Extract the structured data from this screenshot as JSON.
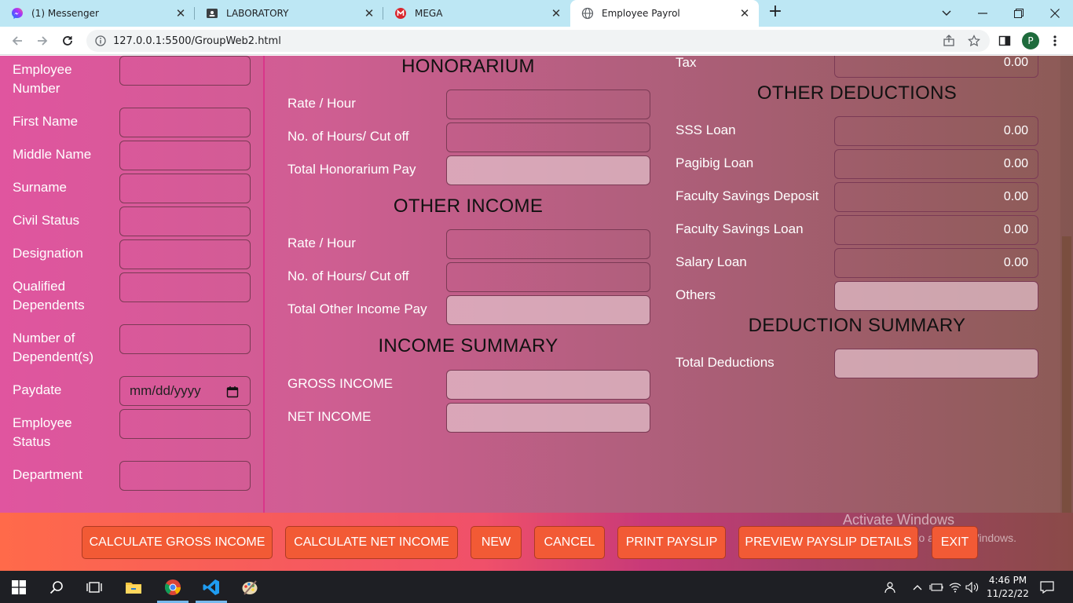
{
  "browser": {
    "tabs": [
      {
        "label": "(1) Messenger",
        "icon": "messenger-icon",
        "active": false
      },
      {
        "label": "LABORATORY",
        "icon": "classroom-icon",
        "active": false
      },
      {
        "label": "MEGA",
        "icon": "mega-icon",
        "active": false
      },
      {
        "label": "Employee Payrol",
        "icon": "globe-icon",
        "active": true
      }
    ],
    "url": "127.0.0.1:5500/GroupWeb2.html",
    "profile_initial": "P"
  },
  "employee": {
    "fields": [
      {
        "label": "Employee Number",
        "value": ""
      },
      {
        "label": "First Name",
        "value": ""
      },
      {
        "label": "Middle Name",
        "value": ""
      },
      {
        "label": "Surname",
        "value": ""
      },
      {
        "label": "Civil Status",
        "value": ""
      },
      {
        "label": "Designation",
        "value": ""
      },
      {
        "label": "Qualified Dependents",
        "value": ""
      },
      {
        "label": "Number of Dependent(s)",
        "value": ""
      },
      {
        "label": "Paydate",
        "value": "",
        "placeholder": "mm/dd/yyyy"
      },
      {
        "label": "Employee Status",
        "value": ""
      },
      {
        "label": "Department",
        "value": ""
      }
    ]
  },
  "honorarium": {
    "title": "HONORARIUM",
    "rate_label": "Rate / Hour",
    "hours_label": "No. of Hours/ Cut off",
    "total_label": "Total Honorarium Pay"
  },
  "other_income": {
    "title": "OTHER INCOME",
    "rate_label": "Rate / Hour",
    "hours_label": "No. of Hours/ Cut off",
    "total_label": "Total Other Income Pay"
  },
  "income_summary": {
    "title": "INCOME SUMMARY",
    "gross_label": "GROSS INCOME",
    "net_label": "NET INCOME"
  },
  "deductions": {
    "tax_label": "Tax",
    "tax_value": "0.00",
    "other_title": "OTHER DEDUCTIONS",
    "items": [
      {
        "label": "SSS Loan",
        "value": "0.00"
      },
      {
        "label": "Pagibig Loan",
        "value": "0.00"
      },
      {
        "label": "Faculty Savings Deposit",
        "value": "0.00"
      },
      {
        "label": "Faculty Savings Loan",
        "value": "0.00"
      },
      {
        "label": "Salary Loan",
        "value": "0.00"
      }
    ],
    "others_label": "Others",
    "summary_title": "DEDUCTION SUMMARY",
    "total_label": "Total Deductions"
  },
  "actions": {
    "calc_gross": "CALCULATE GROSS INCOME",
    "calc_net": "CALCULATE NET INCOME",
    "new": "NEW",
    "cancel": "CANCEL",
    "print": "PRINT PAYSLIP",
    "preview": "PREVIEW PAYSLIP DETAILS",
    "exit": "EXIT"
  },
  "watermark": {
    "title": "Activate Windows",
    "subtitle": "Go to Settings to activate Windows."
  },
  "taskbar": {
    "time": "4:46 PM",
    "date": "11/22/22"
  },
  "colors": {
    "button_bg": "#f25a35",
    "left_gradient": "#e0559f",
    "right_gradient": "#8c5b56"
  }
}
